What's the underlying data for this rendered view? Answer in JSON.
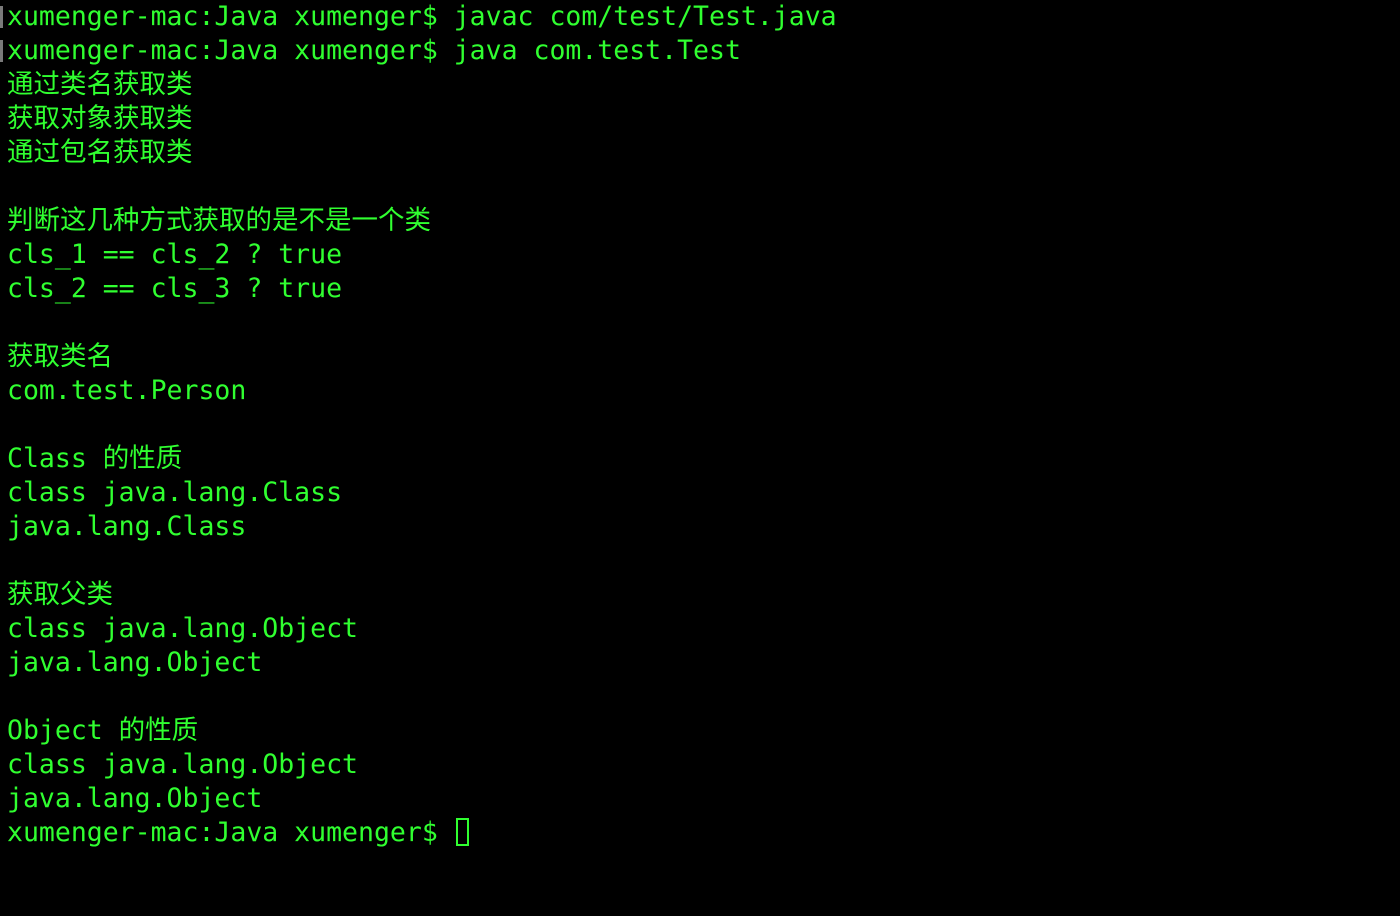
{
  "terminal": {
    "colors": {
      "background": "#000000",
      "foreground": "#30ff30"
    },
    "lines": [
      "xumenger-mac:Java xumenger$ javac com/test/Test.java",
      "xumenger-mac:Java xumenger$ java com.test.Test",
      "通过类名获取类",
      "获取对象获取类",
      "通过包名获取类",
      "",
      "判断这几种方式获取的是不是一个类",
      "cls_1 == cls_2 ? true",
      "cls_2 == cls_3 ? true",
      "",
      "获取类名",
      "com.test.Person",
      "",
      "Class 的性质",
      "class java.lang.Class",
      "java.lang.Class",
      "",
      "获取父类",
      "class java.lang.Object",
      "java.lang.Object",
      "",
      "Object 的性质",
      "class java.lang.Object",
      "java.lang.Object"
    ],
    "prompt": "xumenger-mac:Java xumenger$ ",
    "cursor_icon": "block-cursor-icon"
  }
}
